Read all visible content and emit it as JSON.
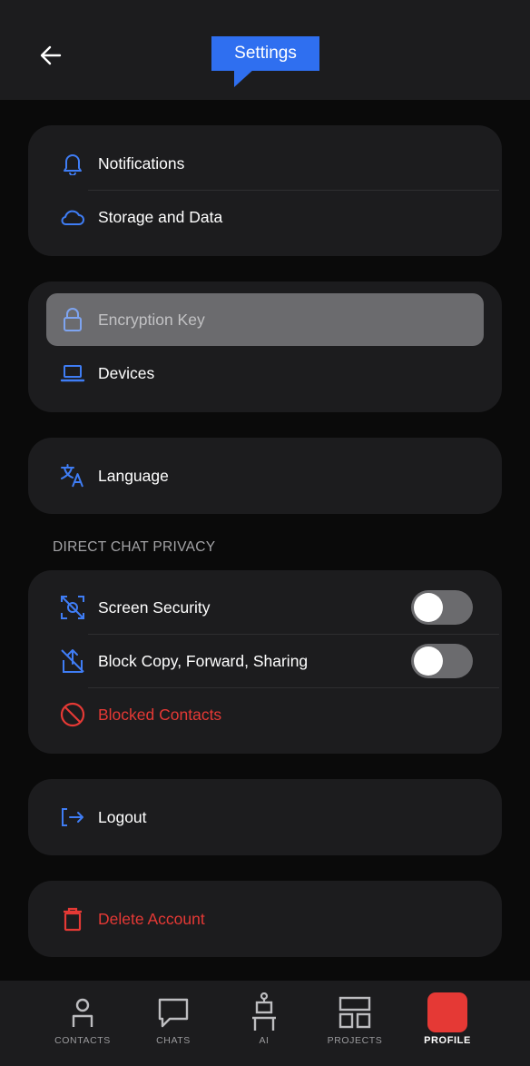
{
  "header": {
    "title": "Settings",
    "back_icon": "arrow-left-icon"
  },
  "groups": {
    "general": [
      {
        "label": "Notifications",
        "icon": "bell-icon"
      },
      {
        "label": "Storage and Data",
        "icon": "cloud-icon"
      }
    ],
    "security": [
      {
        "label": "Encryption Key",
        "icon": "lock-icon",
        "state": "pressed"
      },
      {
        "label": "Devices",
        "icon": "laptop-icon"
      }
    ],
    "language": [
      {
        "label": "Language",
        "icon": "translate-icon"
      }
    ]
  },
  "privacy": {
    "section_title": "DIRECT CHAT PRIVACY",
    "items": [
      {
        "label": "Screen Security",
        "icon": "screen-security-icon",
        "toggle": false
      },
      {
        "label": "Block Copy, Forward, Sharing",
        "icon": "block-share-icon",
        "toggle": false
      },
      {
        "label": "Blocked Contacts",
        "icon": "blocked-icon"
      }
    ]
  },
  "account": {
    "logout": {
      "label": "Logout",
      "icon": "logout-icon"
    },
    "delete": {
      "label": "Delete Account",
      "icon": "trash-icon"
    }
  },
  "tabbar": [
    {
      "label": "CONTACTS",
      "icon": "person-icon"
    },
    {
      "label": "CHATS",
      "icon": "chat-bubble-icon"
    },
    {
      "label": "AI",
      "icon": "robot-icon"
    },
    {
      "label": "PROJECTS",
      "icon": "grid-icon"
    },
    {
      "label": "PROFILE",
      "icon": "profile-icon",
      "active": true
    }
  ],
  "colors": {
    "background": "#0a0a0a",
    "card": "#1c1c1e",
    "accent_blue": "#2f6ff0",
    "danger_red": "#e53935",
    "toggle_off": "#6b6b6e"
  }
}
